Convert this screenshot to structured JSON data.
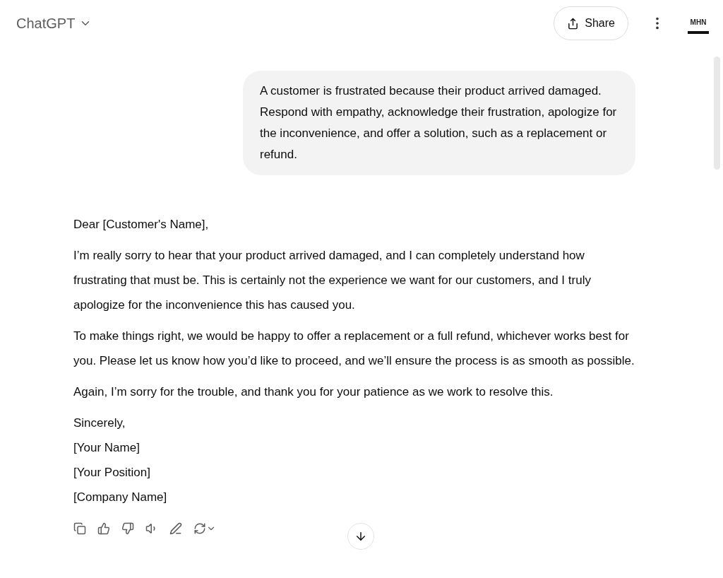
{
  "header": {
    "title": "ChatGPT",
    "share_label": "Share",
    "avatar_text": "MHN"
  },
  "user_message": "A customer is frustrated because their product arrived damaged. Respond with empathy, acknowledge their frustration, apologize for the inconvenience, and offer a solution, such as a replacement or refund.",
  "assistant_paragraphs": [
    {
      "kind": "paragraph",
      "lines": [
        "Dear [Customer's Name],"
      ]
    },
    {
      "kind": "paragraph",
      "lines": [
        "I’m really sorry to hear that your product arrived damaged, and I can completely understand how frustrating that must be. This is certainly not the experience we want for our customers, and I truly apologize for the inconvenience this has caused you."
      ]
    },
    {
      "kind": "paragraph",
      "lines": [
        "To make things right, we would be happy to offer a replacement or a full refund, whichever works best for you. Please let us know how you’d like to proceed, and we’ll ensure the process is as smooth as possible."
      ]
    },
    {
      "kind": "paragraph",
      "lines": [
        "Again, I’m sorry for the trouble, and thank you for your patience as we work to resolve this."
      ]
    },
    {
      "kind": "signature",
      "lines": [
        "Sincerely,",
        "[Your Name]",
        "[Your Position]",
        "[Company Name]"
      ]
    }
  ],
  "actions": [
    {
      "kind": "copy"
    },
    {
      "kind": "like"
    },
    {
      "kind": "dislike"
    },
    {
      "kind": "read"
    },
    {
      "kind": "edit"
    },
    {
      "kind": "regenerate"
    }
  ]
}
